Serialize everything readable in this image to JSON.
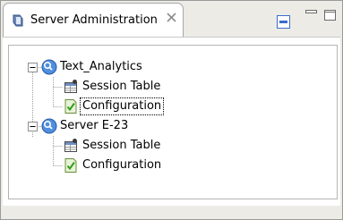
{
  "tab": {
    "title": "Server Administration",
    "icon": "server-admin-icon",
    "close_icon": "close-icon"
  },
  "toolbar": {
    "collapse_icon": "collapse-all-icon",
    "minimize_icon": "minimize-icon",
    "maximize_icon": "maximize-icon"
  },
  "tree": {
    "servers": [
      {
        "label": "Text_Analytics",
        "expanded": true,
        "children": [
          {
            "label": "Session Table",
            "icon": "session-table-icon",
            "selected": false
          },
          {
            "label": "Configuration",
            "icon": "configuration-icon",
            "selected": true
          }
        ]
      },
      {
        "label": "Server E-23",
        "expanded": true,
        "children": [
          {
            "label": "Session Table",
            "icon": "session-table-icon",
            "selected": false
          },
          {
            "label": "Configuration",
            "icon": "configuration-icon",
            "selected": false
          }
        ]
      }
    ]
  }
}
